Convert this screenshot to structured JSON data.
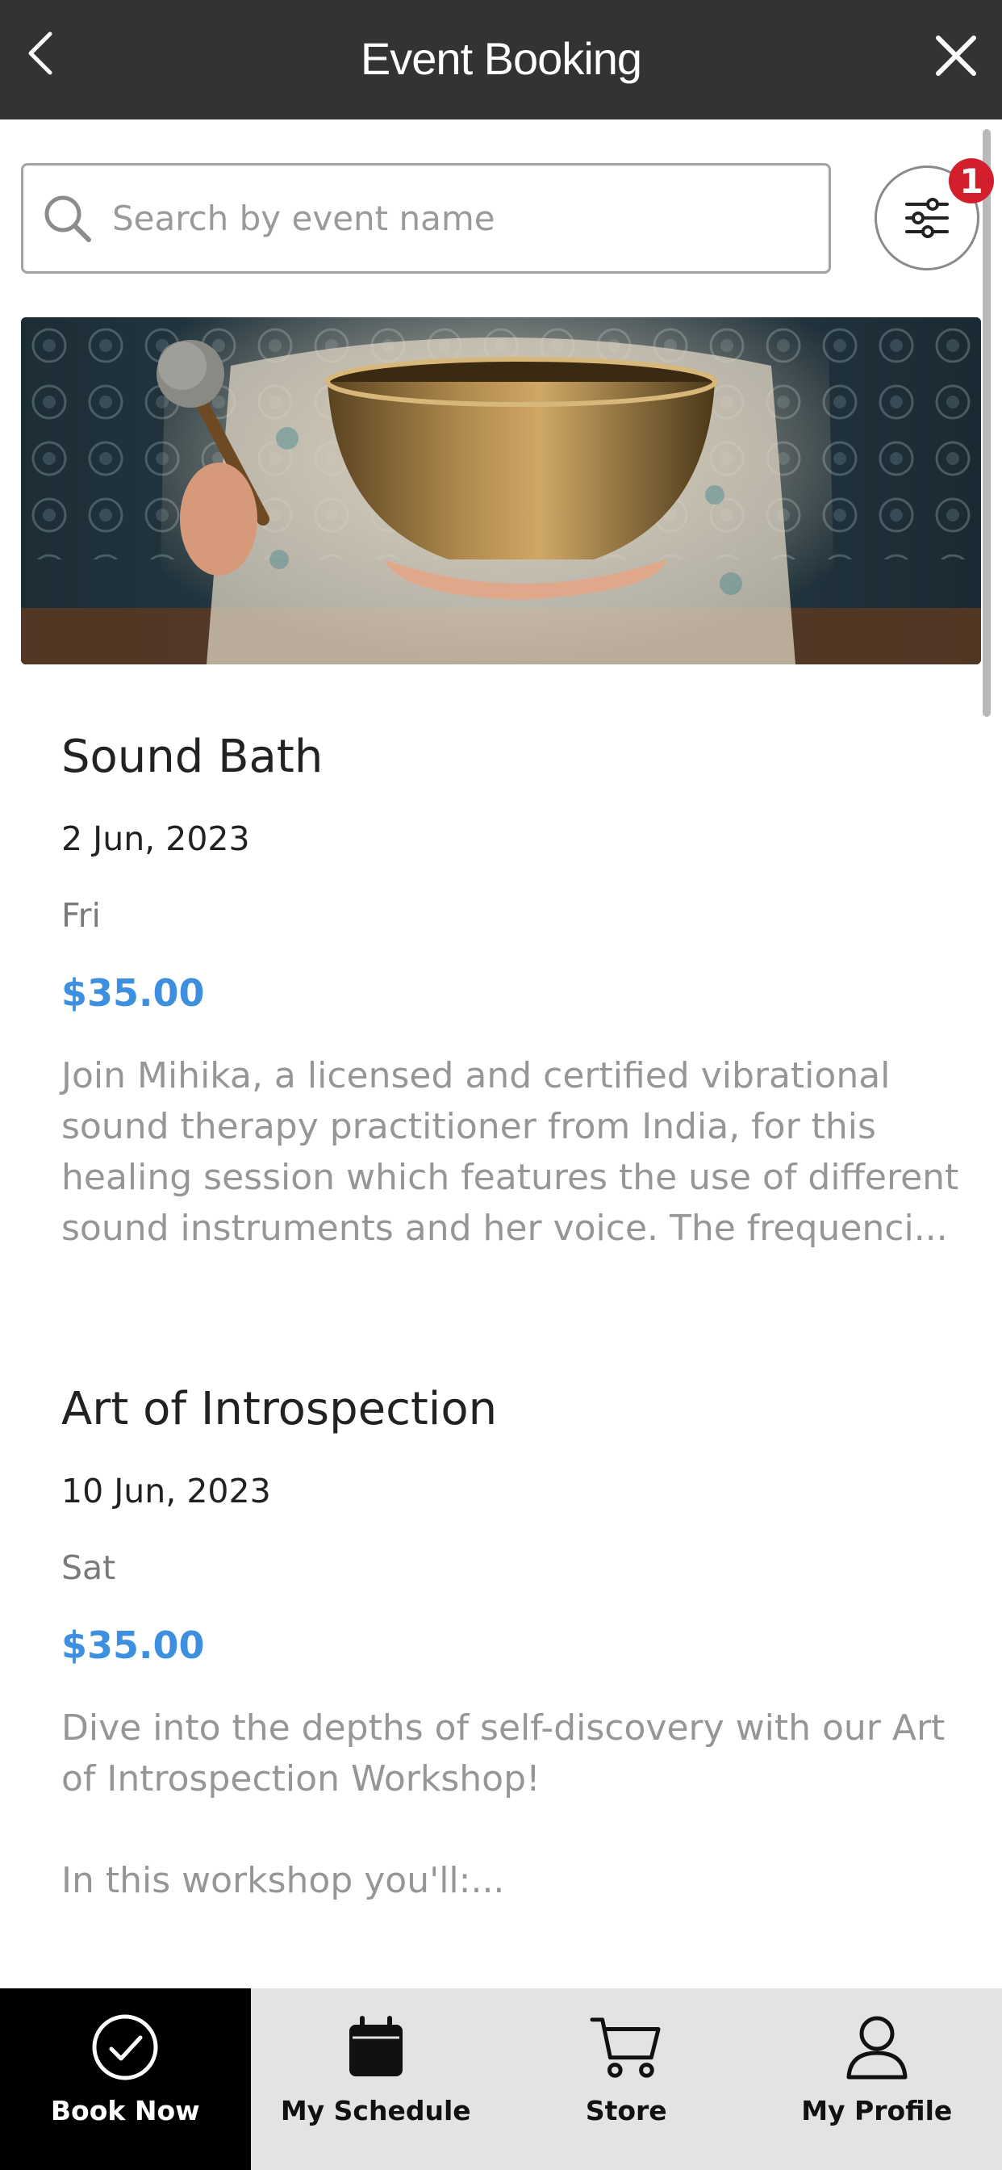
{
  "header": {
    "title": "Event Booking",
    "back_icon": "chevron-left-icon",
    "close_icon": "close-icon",
    "background": "#333333"
  },
  "search": {
    "placeholder": "Search by event name",
    "value": "",
    "icon": "search-icon"
  },
  "filter": {
    "icon": "sliders-icon",
    "badge_count": "1",
    "badge_color": "#d21f2b"
  },
  "events": [
    {
      "name": "Sound Bath",
      "date": "2 Jun, 2023",
      "day": "Fri",
      "price": "$35.00",
      "desc_lines": [
        "Join Mihika, a licensed and certified vibrational",
        "sound therapy practitioner from India, for this",
        "healing session which features the use of different",
        "sound instruments and her voice. The frequenci..."
      ]
    },
    {
      "name": "Art of Introspection",
      "date": "10 Jun, 2023",
      "day": "Sat",
      "price": "$35.00",
      "desc_lines": [
        "Dive into the depths of self-discovery with our Art",
        "of Introspection Workshop!",
        "",
        "In this workshop you'll:..."
      ]
    }
  ],
  "colors": {
    "price": "#3d8fe0",
    "nav_active_bg": "#000000",
    "nav_bg": "#e3e3e3"
  },
  "bottom_nav": [
    {
      "label": "Book Now",
      "icon": "check-circle-icon",
      "active": true
    },
    {
      "label": "My Schedule",
      "icon": "calendar-icon",
      "active": false
    },
    {
      "label": "Store",
      "icon": "cart-icon",
      "active": false
    },
    {
      "label": "My Profile",
      "icon": "user-icon",
      "active": false
    }
  ]
}
